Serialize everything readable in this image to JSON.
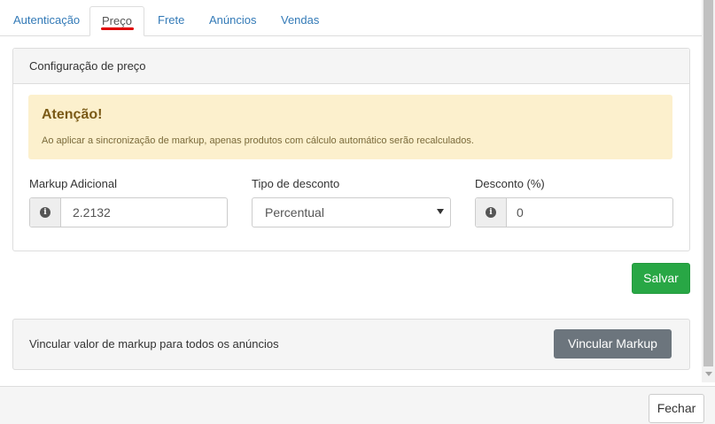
{
  "tabs": [
    {
      "label": "Autenticação"
    },
    {
      "label": "Preço"
    },
    {
      "label": "Frete"
    },
    {
      "label": "Anúncios"
    },
    {
      "label": "Vendas"
    }
  ],
  "active_tab": "Preço",
  "price_panel": {
    "heading": "Configuração de preço",
    "alert": {
      "title": "Atenção!",
      "text": "Ao aplicar a sincronização de markup, apenas produtos com cálculo automático serão recalculados."
    },
    "markup": {
      "label": "Markup Adicional",
      "value": "2.2132"
    },
    "discount_type": {
      "label": "Tipo de desconto",
      "selected": "Percentual"
    },
    "discount": {
      "label": "Desconto (%)",
      "value": "0"
    },
    "save_label": "Salvar"
  },
  "markup_panel": {
    "text": "Vincular valor de markup para todos os anúncios",
    "button_label": "Vincular Markup"
  },
  "footer": {
    "close_label": "Fechar"
  },
  "colors": {
    "link": "#337ab7",
    "active_underline": "#e00000",
    "alert_bg": "#fcf0cd",
    "save_button": "#28a745",
    "markup_button": "#6c757d"
  },
  "icons": [
    "info-icon",
    "chevron-down-icon"
  ]
}
